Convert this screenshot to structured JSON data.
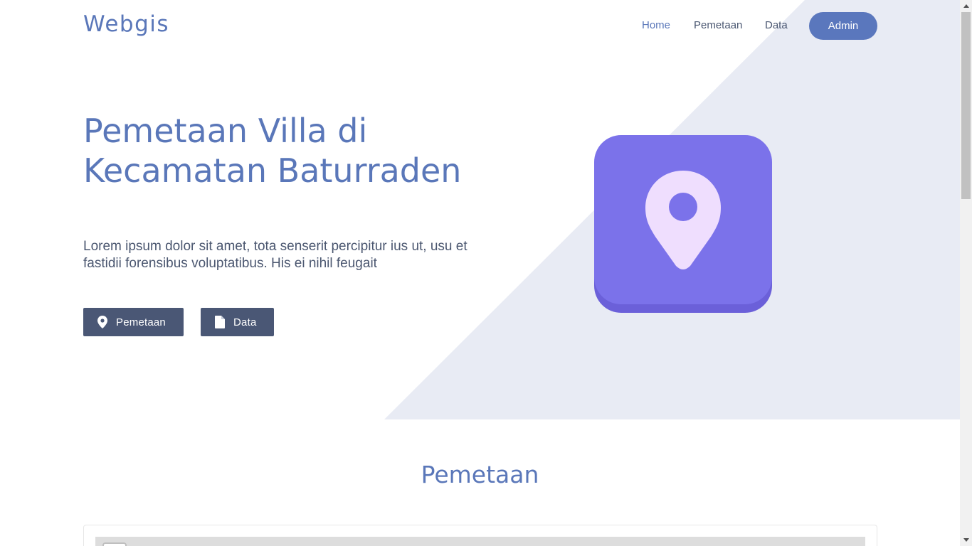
{
  "brand": "Webgis",
  "nav": {
    "items": [
      {
        "label": "Home"
      },
      {
        "label": "Pemetaan"
      },
      {
        "label": "Data"
      }
    ],
    "admin_label": "Admin"
  },
  "hero": {
    "title": "Pemetaan Villa di Kecamatan Baturraden",
    "description": "Lorem ipsum dolor sit amet, tota senserit percipitur ius ut, usu et fastidii forensibus voluptatibus. His ei nihil feugait",
    "buttons": [
      {
        "label": "Pemetaan",
        "icon": "map-marker-icon"
      },
      {
        "label": "Data",
        "icon": "file-icon"
      }
    ]
  },
  "section": {
    "title": "Pemetaan"
  },
  "colors": {
    "accent": "#5a77b9",
    "button_dark": "#4a5775",
    "hero_triangle": "#e8ebf4",
    "map_tile": "#7b72ea",
    "map_pin": "#efdefe"
  }
}
